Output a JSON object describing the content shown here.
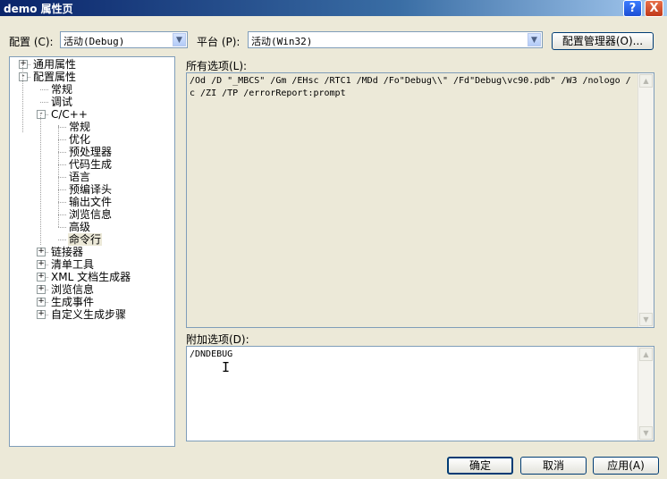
{
  "window": {
    "title": "demo 属性页",
    "help_glyph": "?",
    "close_glyph": "X"
  },
  "toolbar": {
    "config_label": "配置 (C):",
    "config_value": "活动(Debug)",
    "platform_label": "平台 (P):",
    "platform_value": "活动(Win32)",
    "config_manager_label": "配置管理器(O)..."
  },
  "tree": {
    "items": [
      {
        "label": "通用属性",
        "expander": "+"
      },
      {
        "label": "配置属性",
        "expander": "-"
      },
      {
        "label": "常规",
        "expander": ""
      },
      {
        "label": "调试",
        "expander": ""
      },
      {
        "label": "C/C++",
        "expander": "-"
      },
      {
        "label": "常规",
        "expander": ""
      },
      {
        "label": "优化",
        "expander": ""
      },
      {
        "label": "预处理器",
        "expander": ""
      },
      {
        "label": "代码生成",
        "expander": ""
      },
      {
        "label": "语言",
        "expander": ""
      },
      {
        "label": "预编译头",
        "expander": ""
      },
      {
        "label": "输出文件",
        "expander": ""
      },
      {
        "label": "浏览信息",
        "expander": ""
      },
      {
        "label": "高级",
        "expander": ""
      },
      {
        "label": "命令行",
        "expander": "",
        "selected": true
      },
      {
        "label": "链接器",
        "expander": "+"
      },
      {
        "label": "清单工具",
        "expander": "+"
      },
      {
        "label": "XML 文档生成器",
        "expander": "+"
      },
      {
        "label": "浏览信息",
        "expander": "+"
      },
      {
        "label": "生成事件",
        "expander": "+"
      },
      {
        "label": "自定义生成步骤",
        "expander": "+"
      }
    ]
  },
  "all_options": {
    "label": "所有选项(L):",
    "value": "/Od /D \"_MBCS\" /Gm /EHsc /RTC1 /MDd /Fo\"Debug\\\\\" /Fd\"Debug\\vc90.pdb\" /W3 /nologo /c /ZI /TP /errorReport:prompt"
  },
  "additional_options": {
    "label": "附加选项(D):",
    "value": "/DNDEBUG"
  },
  "buttons": {
    "ok": "确定",
    "cancel": "取消",
    "apply": "应用(A)"
  },
  "scroll_glyphs": {
    "up": "▲",
    "down": "▼"
  }
}
